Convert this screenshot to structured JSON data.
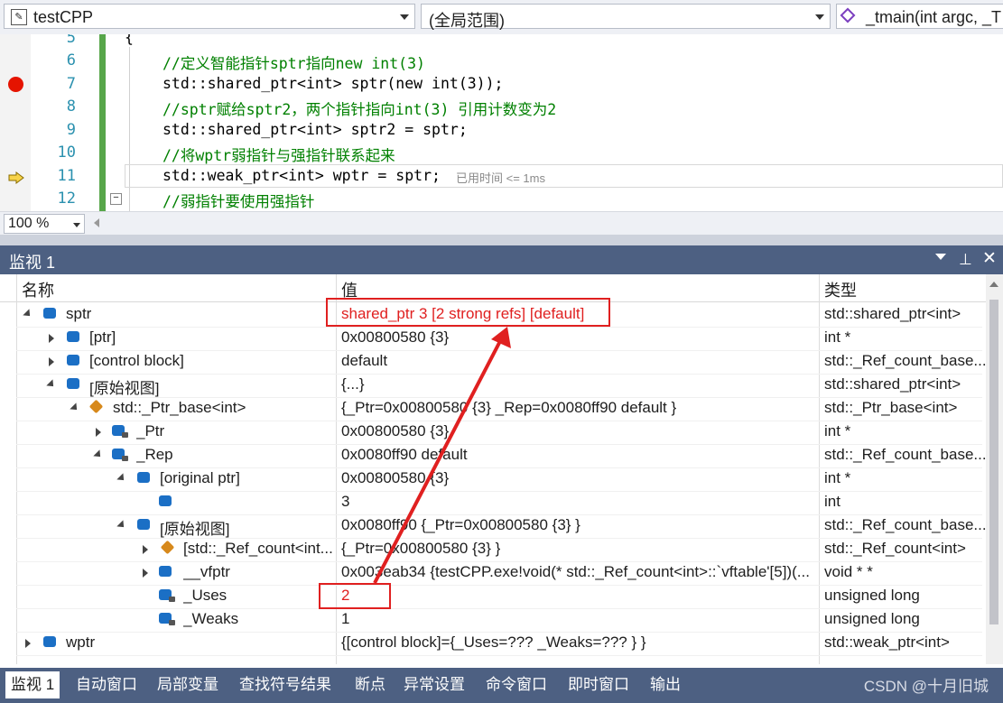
{
  "navbar": {
    "project": "testCPP",
    "scope": "(全局范围)",
    "function": "_tmain(int argc, _T"
  },
  "editor": {
    "lines": [
      {
        "num": "5",
        "text": "{"
      },
      {
        "num": "6",
        "text": "//定义智能指针sptr指向new int(3)"
      },
      {
        "num": "7",
        "text": "std::shared_ptr<int> sptr(new int(3));"
      },
      {
        "num": "8",
        "text": "//sptr赋给sptr2，两个指针指向int(3) 引用计数变为2"
      },
      {
        "num": "9",
        "text": "std::shared_ptr<int> sptr2 = sptr;"
      },
      {
        "num": "10",
        "text": "//将wptr弱指针与强指针联系起来"
      },
      {
        "num": "11",
        "text": "std::weak_ptr<int> wptr = sptr;"
      },
      {
        "num": "12",
        "text": "//弱指针要使用强指针"
      }
    ],
    "elapsed": "已用时间 <= 1ms",
    "zoom": "100 %"
  },
  "watch": {
    "title": "监视 1",
    "headers": {
      "name": "名称",
      "value": "值",
      "type": "类型"
    },
    "rows": [
      {
        "name": "sptr",
        "value": "shared_ptr 3 [2 strong refs] [default]",
        "type": "std::shared_ptr<int>"
      },
      {
        "name": "[ptr]",
        "value": "0x00800580 {3}",
        "type": "int *"
      },
      {
        "name": "[control block]",
        "value": "default",
        "type": "std::_Ref_count_base..."
      },
      {
        "name": "[原始视图]",
        "value": "{...}",
        "type": "std::shared_ptr<int>"
      },
      {
        "name": "std::_Ptr_base<int>",
        "value": "{_Ptr=0x00800580 {3} _Rep=0x0080ff90 default }",
        "type": "std::_Ptr_base<int>"
      },
      {
        "name": "_Ptr",
        "value": "0x00800580 {3}",
        "type": "int *"
      },
      {
        "name": "_Rep",
        "value": "0x0080ff90 default",
        "type": "std::_Ref_count_base..."
      },
      {
        "name": "[original ptr]",
        "value": "0x00800580 {3}",
        "type": "int *"
      },
      {
        "name": "",
        "value": "3",
        "type": "int"
      },
      {
        "name": "[原始视图]",
        "value": "0x0080ff90 {_Ptr=0x00800580 {3} }",
        "type": "std::_Ref_count_base..."
      },
      {
        "name": "[std::_Ref_count<int...",
        "value": "{_Ptr=0x00800580 {3} }",
        "type": "std::_Ref_count<int>"
      },
      {
        "name": "__vfptr",
        "value": "0x003eab34 {testCPP.exe!void(* std::_Ref_count<int>::`vftable'[5])(...",
        "type": "void * *"
      },
      {
        "name": "_Uses",
        "value": "2",
        "type": "unsigned long"
      },
      {
        "name": "_Weaks",
        "value": "1",
        "type": "unsigned long"
      },
      {
        "name": "wptr",
        "value": "{[control block]={_Uses=??? _Weaks=??? } }",
        "type": "std::weak_ptr<int>"
      }
    ]
  },
  "tabs": [
    "监视 1",
    "自动窗口",
    "局部变量",
    "查找符号结果",
    "断点",
    "异常设置",
    "命令窗口",
    "即时窗口",
    "输出"
  ],
  "watermark": "CSDN @十月旧城",
  "colors": {
    "accent": "#4d6082",
    "highlight": "#e02020",
    "comment": "#008000",
    "keyword": "#0000ff",
    "type": "#2b91af"
  }
}
